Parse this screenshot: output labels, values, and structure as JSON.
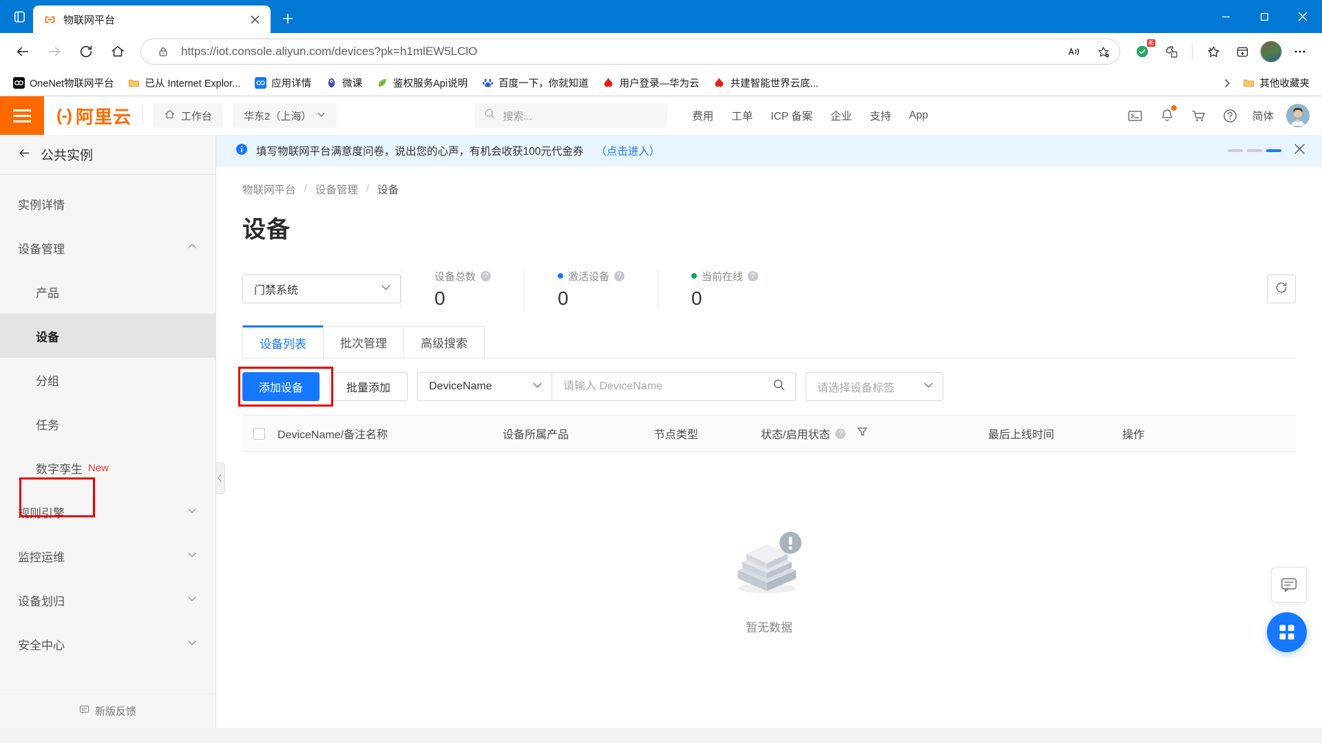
{
  "browser": {
    "tab": {
      "title": "物联网平台",
      "favicon": "aliyun-iot-icon",
      "close": "×"
    },
    "newtab_label": "+",
    "url_scheme": "https://",
    "url_host": "iot.console.aliyun.com",
    "url_path": "/devices?pk=h1mlEW5LClO",
    "url_full": "https://iot.console.aliyun.com/devices?pk=h1mlEW5LClO",
    "window_controls": {
      "minimize": "—",
      "maximize": "□",
      "close": "✕"
    },
    "bookmarks": [
      {
        "label": "OneNet物联网平台",
        "icon": "onenet-icon"
      },
      {
        "label": "已从 Internet Explor...",
        "icon": "folder-icon"
      },
      {
        "label": "应用详情",
        "icon": "onenet-blue-icon"
      },
      {
        "label": "微课",
        "icon": "owl-icon"
      },
      {
        "label": "鉴权服务Api说明",
        "icon": "leaf-icon"
      },
      {
        "label": "百度一下，你就知道",
        "icon": "baidu-icon"
      },
      {
        "label": "用户登录—华为云",
        "icon": "huawei-icon"
      },
      {
        "label": "共建智能世界云底...",
        "icon": "huawei-icon"
      }
    ],
    "bookmarks_overflow_label": "其他收藏夹"
  },
  "header": {
    "logo_text": "阿里云",
    "workbench": "工作台",
    "region": "华东2（上海）",
    "search_placeholder": "搜索...",
    "nav": [
      "费用",
      "工单",
      "ICP 备案",
      "企业",
      "支持",
      "App"
    ],
    "icons": [
      "terminal-icon",
      "bell-icon",
      "cart-icon",
      "help-icon"
    ],
    "language": "简体"
  },
  "sidebar": {
    "back_label": "公共实例",
    "items": [
      {
        "label": "实例详情",
        "level": "top",
        "state": "normal",
        "chevron": ""
      },
      {
        "label": "设备管理",
        "level": "top",
        "state": "expanded",
        "chevron": "︿"
      },
      {
        "label": "产品",
        "level": "sub",
        "state": "normal",
        "chevron": ""
      },
      {
        "label": "设备",
        "level": "sub",
        "state": "active",
        "chevron": ""
      },
      {
        "label": "分组",
        "level": "sub",
        "state": "normal",
        "chevron": ""
      },
      {
        "label": "任务",
        "level": "sub",
        "state": "normal",
        "chevron": ""
      },
      {
        "label": "数字孪生",
        "level": "sub",
        "state": "normal",
        "badge": "New",
        "chevron": ""
      },
      {
        "label": "规则引擎",
        "level": "top",
        "state": "collapsed",
        "chevron": "﹀"
      },
      {
        "label": "监控运维",
        "level": "top",
        "state": "collapsed",
        "chevron": "﹀"
      },
      {
        "label": "设备划归",
        "level": "top",
        "state": "collapsed",
        "chevron": "﹀"
      },
      {
        "label": "安全中心",
        "level": "top",
        "state": "collapsed",
        "chevron": "﹀"
      }
    ],
    "footer_label": "新版反馈"
  },
  "notice": {
    "text": "填写物联网平台满意度问卷，说出您的心声，有机会收获100元代金券",
    "link": "（点击进入）",
    "close": "✕"
  },
  "main": {
    "breadcrumb": [
      "物联网平台",
      "设备管理",
      "设备"
    ],
    "breadcrumb_sep": "/",
    "page_title": "设备",
    "product_select": {
      "value": "门禁系统",
      "chevron": "⌄"
    },
    "stats": [
      {
        "label": "设备总数",
        "value": "0",
        "bullet": "",
        "help": "?"
      },
      {
        "label": "激活设备",
        "value": "0",
        "bullet": "#1677ff",
        "help": "?"
      },
      {
        "label": "当前在线",
        "value": "0",
        "bullet": "#00a854",
        "help": "?"
      }
    ],
    "refresh_icon": "refresh-icon",
    "tabs": [
      {
        "label": "设备列表",
        "active": true
      },
      {
        "label": "批次管理",
        "active": false
      },
      {
        "label": "高级搜索",
        "active": false
      }
    ],
    "toolbar": {
      "add_device": "添加设备",
      "batch_add": "批量添加",
      "field_select": "DeviceName",
      "search_placeholder": "请输入 DeviceName",
      "search_value": "",
      "tag_select": "请选择设备标签",
      "chevron": "⌄"
    },
    "table": {
      "columns": [
        "DeviceName/备注名称",
        "设备所属产品",
        "节点类型",
        "状态/启用状态",
        "最后上线时间",
        "操作"
      ],
      "status_help": "?",
      "filter_icon": "filter-icon",
      "rows": []
    },
    "empty_text": "暂无数据",
    "fab_chat": "chat-icon",
    "fab_grid": "apps-grid-icon"
  },
  "colors": {
    "accent_blue": "#1677ff",
    "brand_orange": "#ff6a00",
    "highlight_red": "#e60000",
    "online_green": "#00a854",
    "browser_blue": "#0078d4"
  }
}
